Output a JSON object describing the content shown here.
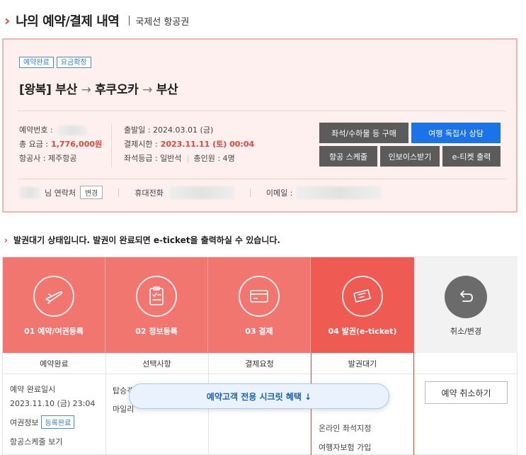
{
  "header": {
    "title": "나의 예약/결제 내역",
    "subtitle": "국제선 항공권"
  },
  "booking": {
    "badges": [
      "예약완료",
      "요금확정"
    ],
    "route": {
      "trip_type": "[왕복]",
      "origin": "부산",
      "destination": "후쿠오카",
      "return": "부산",
      "arrow": "→"
    },
    "info": {
      "reservation_no_label": "예약번호 :",
      "total_fare_label": "총 요금 :",
      "total_fare_value": "1,776,000원",
      "airline_label": "항공사 : 제주항공",
      "departure_label": "출발일 : 2024.03.01 (금)",
      "payment_deadline_label": "결제시한 :",
      "payment_deadline_value": "2023.11.11 (토) 00:04",
      "seat_class_label": "좌석등급 : 일반석",
      "passengers_label": "총인원 : 4명"
    },
    "buttons": {
      "seat_baggage": "좌석/수하물 등 구매",
      "consult": "여행 독집사 상담",
      "schedule": "항공 스케줄",
      "invoice": "인보이스받기",
      "eticket": "e-티켓 출력"
    },
    "contact": {
      "name_suffix": "님 연락처",
      "change_label": "변경",
      "mobile_label": "휴대전화",
      "email_label": "이메일 :"
    }
  },
  "notice": "발권대기 상태입니다. 발권이 완료되면 e-ticket을 출력하실 수 있습니다.",
  "steps": [
    {
      "label": "01 예약/여권등록",
      "icon": "airplane-icon",
      "sub": "예약완료"
    },
    {
      "label": "02 정보등록",
      "icon": "clipboard-icon",
      "sub": "선택사항"
    },
    {
      "label": "03 결제",
      "icon": "credit-card-icon",
      "sub": "결제요청"
    },
    {
      "label": "04 발권(e-ticket)",
      "icon": "ticket-icon",
      "sub": "발권대기"
    },
    {
      "label": "취소/변경",
      "icon": "undo-icon",
      "sub": ""
    }
  ],
  "details": {
    "booked_at_label": "예약 완료일시",
    "booked_at_value": "2023.11.10 (금) 23:04",
    "passport_label": "여권정보",
    "passport_status": "등록완료",
    "schedule_link": "항공스케줄 보기",
    "col2_a": "탑승객",
    "col2_b": "마일리",
    "col4_a": "온라인 좌석지정",
    "col4_b": "여행자보험 가입",
    "cancel_button": "예약 취소하기"
  },
  "banner": "예약고객 전용 시크릿 혜택 ↓",
  "colors": {
    "accent_red": "#e6463c",
    "step_pink": "#f27670",
    "step_active": "#ef5a52",
    "blue_button": "#1a73e8"
  }
}
